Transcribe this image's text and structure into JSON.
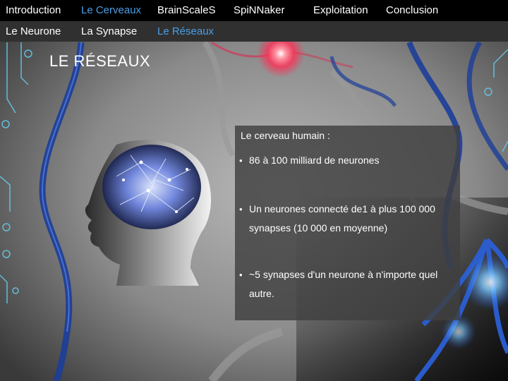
{
  "nav": {
    "top": [
      {
        "label": "Introduction",
        "active": false
      },
      {
        "label": "Le Cerveaux",
        "active": true
      },
      {
        "label": "BrainScaleS",
        "active": false
      },
      {
        "label": "SpiNNaker",
        "active": false
      },
      {
        "label": "Exploitation",
        "active": false
      },
      {
        "label": "Conclusion",
        "active": false
      }
    ],
    "sub": [
      {
        "label": "Le Neurone",
        "active": false
      },
      {
        "label": "La Synapse",
        "active": false
      },
      {
        "label": "Le Réseaux",
        "active": true
      }
    ]
  },
  "slide": {
    "title": "LE RÉSEAUX",
    "box_heading": "Le cerveau humain :",
    "bullets": [
      "86 à 100 milliard de neurones",
      "Un neurones connecté de1 à plus 100 000 synapses (10 000 en moyenne)",
      "~5 synapses d'un neurone à n'importe quel autre."
    ],
    "bullet_glyph": "•"
  },
  "colors": {
    "accent": "#4a9fe6",
    "nav_top_bg": "#000000",
    "nav_sub_bg": "#303030",
    "neuron_blue": "#1e4fb8",
    "neuron_glow": "#9fdcff",
    "red_glow": "#ff3b5a"
  }
}
